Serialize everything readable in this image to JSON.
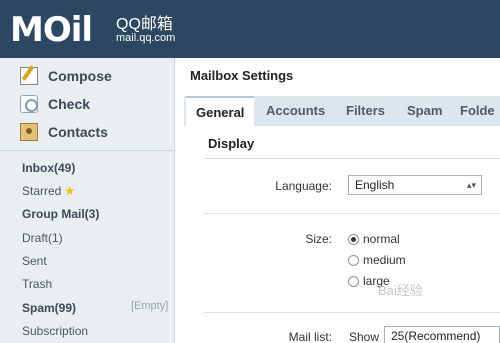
{
  "header": {
    "logo_text": "MOil",
    "brand": "QQ邮箱",
    "domain": "mail.qq.com"
  },
  "sidebar": {
    "actions": [
      {
        "label": "Compose",
        "icon": "compose-icon"
      },
      {
        "label": "Check",
        "icon": "check-icon"
      },
      {
        "label": "Contacts",
        "icon": "contacts-icon"
      }
    ],
    "folders": [
      {
        "label": "Inbox(49)"
      },
      {
        "label": "Starred"
      },
      {
        "label": "Group Mail(3)"
      },
      {
        "label": "Draft(1)"
      },
      {
        "label": "Sent"
      },
      {
        "label": "Trash"
      },
      {
        "label": "Spam(99)"
      },
      {
        "label": "Subscription"
      }
    ],
    "empty_label": "[Empty]"
  },
  "main": {
    "title": "Mailbox Settings",
    "tabs": [
      {
        "label": "General"
      },
      {
        "label": "Accounts"
      },
      {
        "label": "Filters"
      },
      {
        "label": "Spam"
      },
      {
        "label": "Folde"
      }
    ]
  },
  "display": {
    "section_title": "Display",
    "language_label": "Language:",
    "language_value": "English",
    "size_label": "Size:",
    "size_options": [
      "normal",
      "medium",
      "large"
    ],
    "size_selected": "normal",
    "mail_list_label": "Mail list:",
    "show_label": "Show",
    "mail_list_value": "25(Recommend)"
  },
  "colors": {
    "header_bg": "#2c4762",
    "sidebar_bg": "#e9eef3",
    "tabbar_bg": "#dde6ee",
    "star": "#f5c000"
  },
  "watermark": "Bai经验"
}
